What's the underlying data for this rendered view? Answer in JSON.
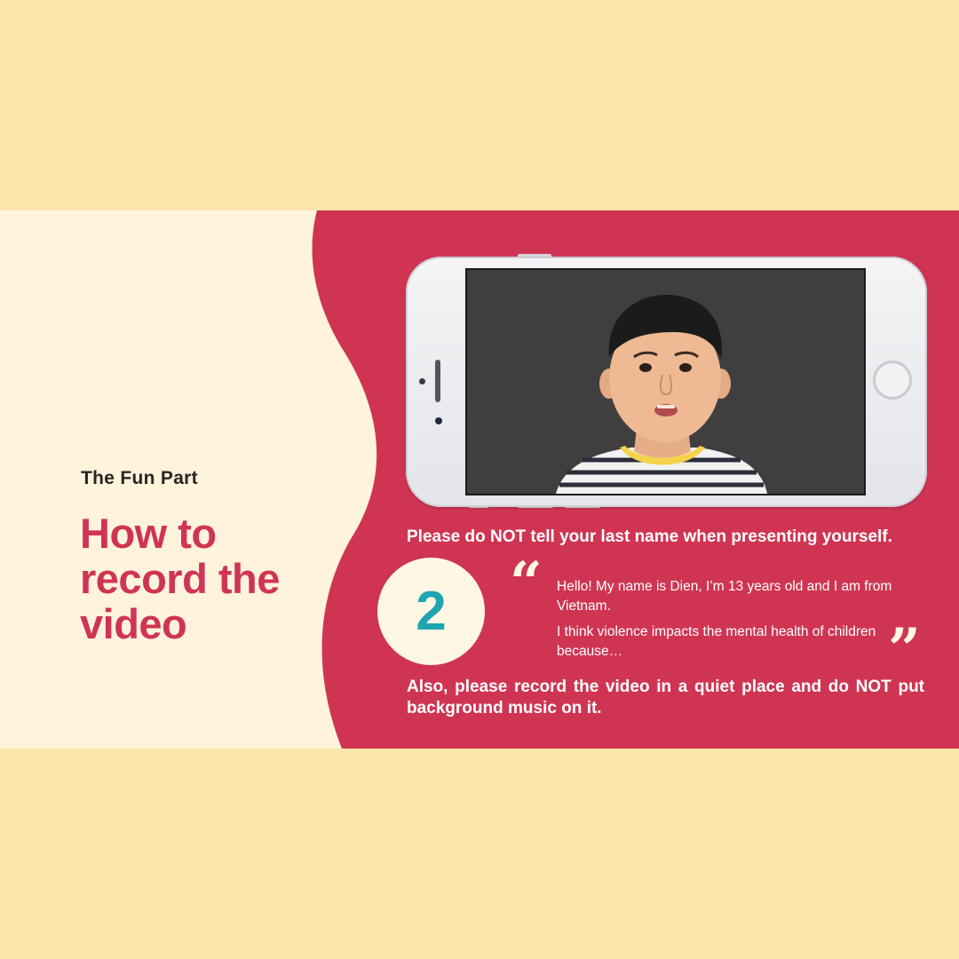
{
  "eyebrow": "The Fun Part",
  "title": "How to record the video",
  "instruction_top": "Please do NOT tell your last name when presenting yourself.",
  "step_number": "2",
  "quote": {
    "line1": "Hello! My name is Dien, I’m 13 years old and I am from Vietnam.",
    "line2": "I think violence impacts the mental health of children because…",
    "open_mark": "“",
    "close_mark": "”"
  },
  "instruction_bottom": "Also, please record the video in a quiet place and do NOT put background music on it.",
  "colors": {
    "outer_bg": "#fde6ac",
    "panel_cream": "#fff3dc",
    "panel_red": "#cf3553",
    "title": "#cf3553",
    "step_number": "#1fa5b2"
  },
  "icons": [
    "phone-icon",
    "home-button-icon",
    "quote-open-icon",
    "quote-close-icon"
  ]
}
